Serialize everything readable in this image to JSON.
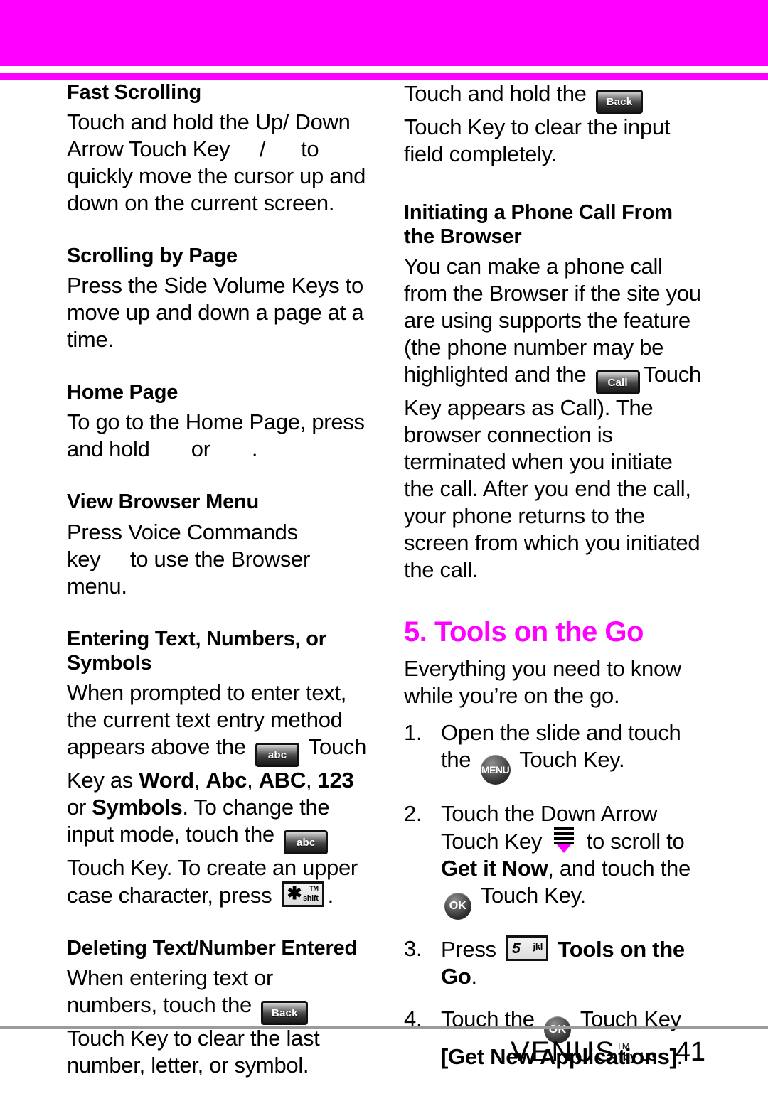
{
  "page": {
    "number": "41",
    "brand": "VENUS",
    "brand_tm": "TM",
    "brand_by": "by LG",
    "header_color": "#ff00ff",
    "accent_color": "#ff00ff",
    "rule_color": "#9b9b9b"
  },
  "left_column": {
    "fast_scrolling": {
      "heading": "Fast Scrolling",
      "text_a": "Touch and hold the Up/ Down Arrow Touch Key",
      "text_sep": "/",
      "text_b": "to quickly move the cursor up and down on the current screen."
    },
    "scrolling_by_page": {
      "heading": "Scrolling by Page",
      "text": "Press the Side Volume Keys to move up and down a page at a time."
    },
    "home_page": {
      "heading": "Home Page",
      "text_a": "To go to the Home Page, press and hold",
      "text_or": "or",
      "text_b": "."
    },
    "view_browser_menu": {
      "heading": "View Browser Menu",
      "text_a": "Press Voice Commands key",
      "text_b": "to use the Browser menu."
    },
    "entering_text": {
      "heading": "Entering Text, Numbers, or Symbols",
      "text_a": "When prompted to enter text, the current text entry method appears above the",
      "key_abc_1": "abc",
      "text_b": "Touch Key as",
      "mode_word": "Word",
      "mode_sep1": ", ",
      "mode_abc": "Abc",
      "mode_sep2": ", ",
      "mode_abc_upper": "ABC",
      "mode_sep3": ", ",
      "mode_123": "123",
      "mode_or": " or ",
      "mode_symbols": "Symbols",
      "text_c": ". To change the input mode, touch the",
      "key_abc_2": "abc",
      "text_d": "Touch Key. To create an upper case character, press",
      "key_shift_main": "✱",
      "key_shift_top": "TM",
      "key_shift_bottom": "shift",
      "text_e": "."
    },
    "deleting_text": {
      "heading": "Deleting Text/Number Entered",
      "text_a": "When entering text or numbers, touch the",
      "key_back": "Back",
      "text_b": "Touch Key to clear the last number, letter, or symbol."
    }
  },
  "right_column": {
    "clear_field": {
      "text_a": "Touch and hold the",
      "key_back": "Back",
      "text_b": "Touch Key to clear the input field completely."
    },
    "initiating_call": {
      "heading": "Initiating a Phone Call From the Browser",
      "text_a": "You can make a phone call from the Browser if the site you are using supports the feature (the phone number may be highlighted and the",
      "key_call": "Call",
      "text_b": "Touch Key appears as Call). The browser connection is terminated when you initiate the call. After you end the call, your phone returns to the screen from which you initiated the call."
    },
    "tools_on_the_go": {
      "heading": "5. Tools on the Go",
      "intro": "Everything you need to know while you’re on the go.",
      "steps": [
        {
          "num": "1.",
          "text_a": "Open the slide and touch the",
          "key": "MENU",
          "text_b": "Touch Key."
        },
        {
          "num": "2.",
          "text_a": "Touch the Down Arrow Touch Key",
          "key_arrow": "down-arrow",
          "text_b": "to scroll to",
          "bold_b": "Get it Now",
          "text_c": ", and touch the",
          "key_ok": "OK",
          "text_d": "Touch Key."
        },
        {
          "num": "3.",
          "text_a": "Press",
          "key_main": "5",
          "key_sub": "jkl",
          "bold_b": "Tools on the Go",
          "text_c": "."
        },
        {
          "num": "4.",
          "text_a": "Touch the",
          "key_ok": "OK",
          "text_b": "Touch Key",
          "bold_b": "[Get New Applications]",
          "text_c": "."
        }
      ]
    }
  }
}
